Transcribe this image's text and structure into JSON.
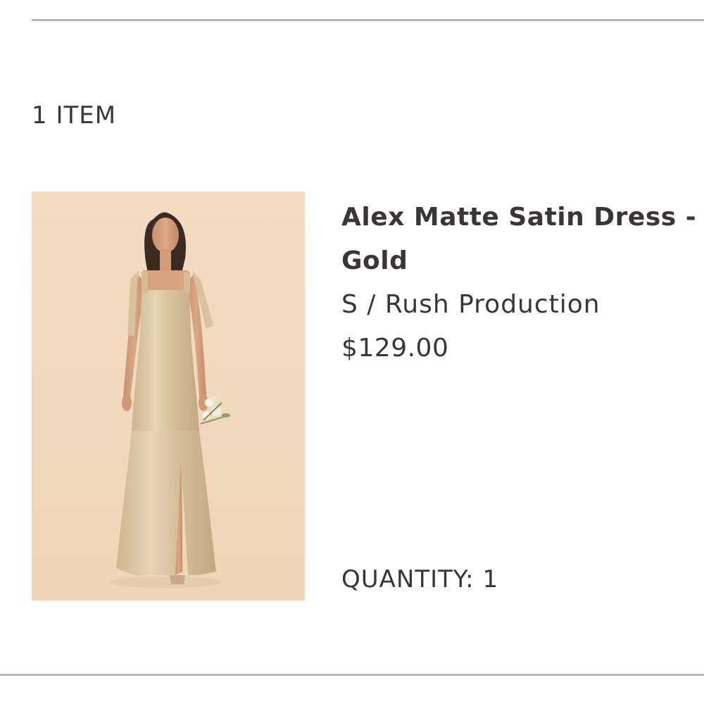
{
  "cart": {
    "item_count_label": "1 ITEM"
  },
  "item": {
    "name": "Alex Matte Satin Dress - Gold",
    "variant": "S / Rush Production",
    "price": "$129.00",
    "quantity_label": "QUANTITY:",
    "quantity_value": "1"
  },
  "colors": {
    "image_background": "#f1dcc1",
    "dress": "#d8c3a2",
    "text": "#3a3536",
    "rule": "#b9b4b6"
  }
}
